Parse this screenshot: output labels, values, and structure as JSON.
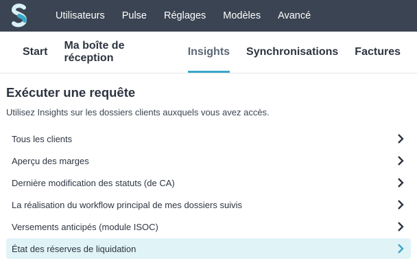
{
  "topbar": {
    "nav": [
      "Utilisateurs",
      "Pulse",
      "Réglages",
      "Modèles",
      "Avancé"
    ],
    "colors": {
      "background": "#3b4452",
      "logo_light": "#d9f1f6",
      "logo_accent": "#3aa7c7"
    }
  },
  "tabs": [
    "Start",
    "Ma boîte de réception",
    "Insights",
    "Synchronisations",
    "Factures"
  ],
  "active_tab": "Insights",
  "main": {
    "title": "Exécuter une requête",
    "subtitle": "Utilisez Insights sur les dossiers clients auxquels vous avez accès.",
    "queries": [
      "Tous les clients",
      "Aperçu des marges",
      "Dernière modification des statuts (de CA)",
      "La réalisation du workflow principal de mes dossiers suivis",
      "Versements anticipés (module ISOC)",
      "État des réserves de liquidation"
    ],
    "highlighted_query": "État des réserves de liquidation"
  },
  "colors": {
    "accent": "#3aa7c7",
    "highlight_bg": "#e0f3f7",
    "text": "#2d3440"
  }
}
